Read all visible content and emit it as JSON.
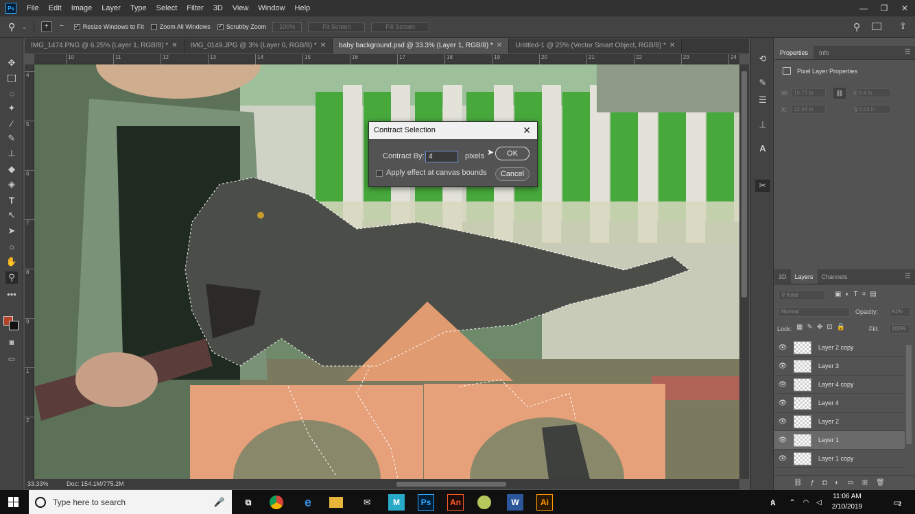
{
  "app": {
    "logo": "Ps"
  },
  "menu": [
    "File",
    "Edit",
    "Image",
    "Layer",
    "Type",
    "Select",
    "Filter",
    "3D",
    "View",
    "Window",
    "Help"
  ],
  "window_controls": {
    "minimize": "—",
    "restore": "❐",
    "close": "✕"
  },
  "options": {
    "resize_windows": "Resize Windows to Fit",
    "zoom_all": "Zoom All Windows",
    "scrubby_zoom": "Scrubby Zoom",
    "zoom_100": "100%",
    "fit_screen": "Fit Screen",
    "fill_screen": "Fill Screen"
  },
  "tabs": [
    {
      "label": "IMG_1474.PNG @ 6.25% (Layer 1, RGB/8) *",
      "active": false
    },
    {
      "label": "IMG_0149.JPG @ 3% (Layer 0, RGB/8) *",
      "active": false
    },
    {
      "label": "baby background.psd @ 33.3% (Layer 1, RGB/8) *",
      "active": true
    },
    {
      "label": "Untitled-1 @ 25% (Vector Smart Object, RGB/8) *",
      "active": false
    }
  ],
  "ruler_h": [
    "10",
    "11",
    "12",
    "13",
    "14",
    "15",
    "16",
    "17",
    "18",
    "19",
    "20",
    "21",
    "22",
    "23",
    "24"
  ],
  "ruler_v": [
    "4",
    "5",
    "6",
    "7",
    "8",
    "9",
    "1",
    "2"
  ],
  "status": {
    "zoom": "33.33%",
    "doc": "Doc: 154.1M/775.2M"
  },
  "dialog": {
    "title": "Contract Selection",
    "contract_label": "Contract By:",
    "contract_value": "4",
    "unit": "pixels",
    "apply_label": "Apply effect at canvas bounds",
    "ok": "OK",
    "cancel": "Cancel"
  },
  "properties": {
    "tab_properties": "Properties",
    "tab_info": "Info",
    "heading": "Pixel Layer Properties",
    "w_label": "W:",
    "w_value": "10.73 in",
    "h_label": "H:",
    "h_value": "8.4 in",
    "x_label": "X:",
    "x_value": "12.44 in",
    "y_label": "Y:",
    "y_value": "6.24 in"
  },
  "layers": {
    "tab_3d": "3D",
    "tab_layers": "Layers",
    "tab_channels": "Channels",
    "kind": "Kind",
    "blend_mode": "Normal",
    "opacity_label": "Opacity:",
    "opacity_value": "91%",
    "lock_label": "Lock:",
    "fill_label": "Fill:",
    "fill_value": "100%",
    "rows": [
      {
        "name": "Layer 2 copy",
        "selected": false
      },
      {
        "name": "Layer 3",
        "selected": false
      },
      {
        "name": "Layer 4 copy",
        "selected": false
      },
      {
        "name": "Layer 4",
        "selected": false
      },
      {
        "name": "Layer 2",
        "selected": false
      },
      {
        "name": "Layer 1",
        "selected": true
      },
      {
        "name": "Layer 1 copy",
        "selected": false
      }
    ]
  },
  "taskbar": {
    "search_placeholder": "Type here to search",
    "time": "11:06 AM",
    "date": "2/10/2019",
    "notif_count": "2",
    "apps": [
      "Ps",
      "An",
      "Ai"
    ]
  }
}
